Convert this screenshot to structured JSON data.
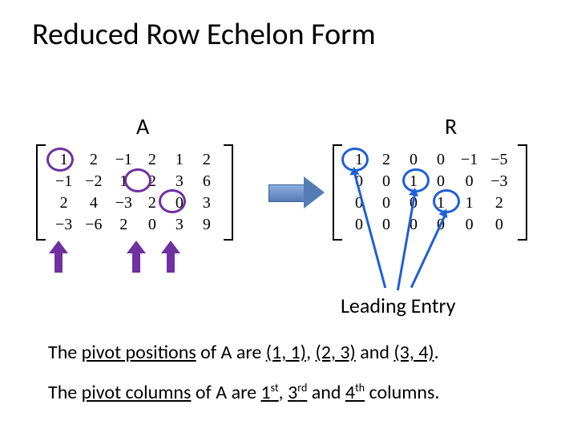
{
  "title": "Reduced Row Echelon Form",
  "labels": {
    "A": "A",
    "R": "R",
    "leading": "Leading Entry"
  },
  "matrix_a": [
    [
      "1",
      "2",
      "−1",
      "2",
      "1",
      "2"
    ],
    [
      "−1",
      "−2",
      "1",
      "2",
      "3",
      "6"
    ],
    [
      "2",
      "4",
      "−3",
      "2",
      "0",
      "3"
    ],
    [
      "−3",
      "−6",
      "2",
      "0",
      "3",
      "9"
    ]
  ],
  "matrix_r": [
    [
      "1",
      "2",
      "0",
      "0",
      "−1",
      "−5"
    ],
    [
      "0",
      "0",
      "1",
      "0",
      "0",
      "−3"
    ],
    [
      "0",
      "0",
      "0",
      "1",
      "1",
      "2"
    ],
    [
      "0",
      "0",
      "0",
      "0",
      "0",
      "0"
    ]
  ],
  "sentence1_parts": {
    "pre": "The ",
    "u1": "pivot positions",
    "mid": " of A are ",
    "p1": "(1, 1)",
    "c1": ", ",
    "p2": "(2, 3)",
    "c2": " and ",
    "p3": "(3, 4)",
    "end": "."
  },
  "sentence2_parts": {
    "pre": "The ",
    "u1": "pivot columns",
    "mid": " of A are ",
    "n1": "1",
    "s1": "st",
    "c1": ", ",
    "n2": "3",
    "s2": "rd",
    "c2": " and ",
    "n3": "4",
    "s3": "th",
    "end": " columns."
  }
}
